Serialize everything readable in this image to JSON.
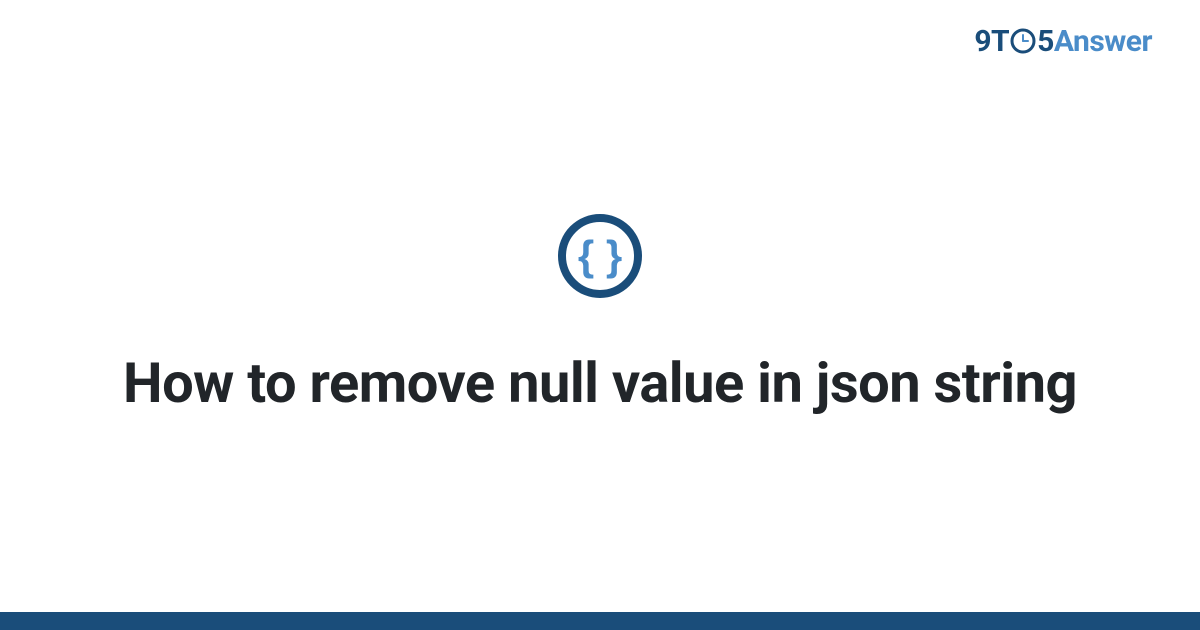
{
  "logo": {
    "part1": "9T",
    "part2": "5",
    "part3": "Answer"
  },
  "title": "How to remove null value in json string",
  "colors": {
    "dark_blue": "#1a4d7a",
    "light_blue": "#4a8cc9",
    "text": "#212529"
  }
}
